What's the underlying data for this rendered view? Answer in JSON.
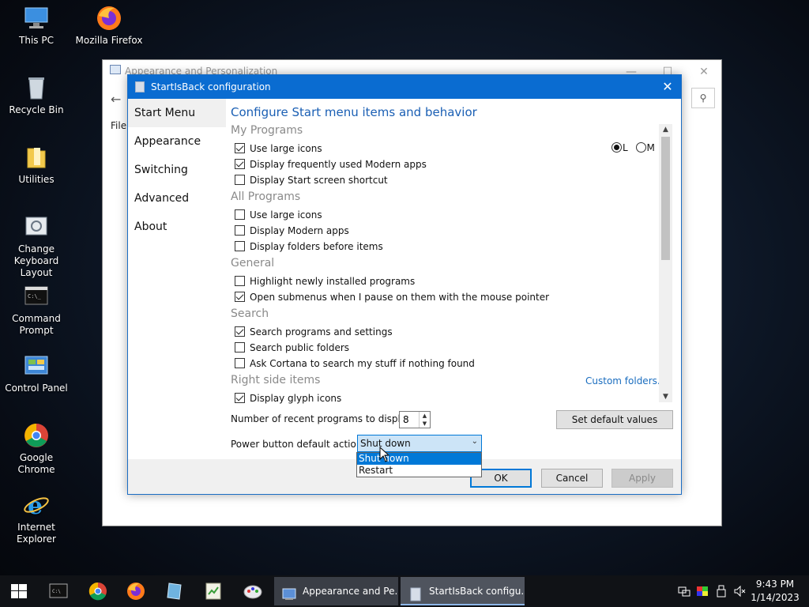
{
  "desktop": {
    "icons": [
      {
        "label": "This PC",
        "icon": "computer-icon"
      },
      {
        "label": "Mozilla Firefox",
        "icon": "firefox-icon"
      },
      {
        "label": "Recycle Bin",
        "icon": "recycle-bin-icon"
      },
      {
        "label": "Utilities",
        "icon": "folder-icon"
      },
      {
        "label": "Change Keyboard Layout",
        "icon": "keyboard-icon"
      },
      {
        "label": "Command Prompt",
        "icon": "cmd-icon"
      },
      {
        "label": "Control Panel",
        "icon": "control-panel-icon"
      },
      {
        "label": "Google Chrome",
        "icon": "chrome-icon"
      },
      {
        "label": "Internet Explorer",
        "icon": "ie-icon"
      }
    ]
  },
  "bg_window": {
    "title": "Appearance and Personalization",
    "back_glyph": "←",
    "file_menu": "File",
    "minimize_glyph": "—",
    "maximize_glyph": "☐",
    "close_glyph": "✕",
    "search_glyph": "⚲"
  },
  "dialog": {
    "title": "StartIsBack configuration",
    "close_glyph": "✕",
    "nav": [
      "Start Menu",
      "Appearance",
      "Switching",
      "Advanced",
      "About"
    ],
    "heading": "Configure Start menu items and behavior",
    "sections": {
      "my_programs": "My Programs",
      "all_programs": "All Programs",
      "general": "General",
      "search": "Search",
      "right_side": "Right side items"
    },
    "options": {
      "use_large_icons_mp": "Use large icons",
      "display_modern_frequent": "Display frequently used Modern apps",
      "display_start_shortcut": "Display Start screen shortcut",
      "use_large_icons_ap": "Use large icons",
      "display_modern_apps": "Display Modern apps",
      "display_folders_before": "Display folders before items",
      "highlight_new": "Highlight newly installed programs",
      "open_submenus": "Open submenus when I pause on them with the mouse pointer",
      "search_programs": "Search programs and settings",
      "search_public": "Search public folders",
      "ask_cortana": "Ask Cortana to search my stuff if nothing found",
      "display_glyph": "Display glyph icons"
    },
    "size_radio": {
      "large": "L",
      "medium": "M"
    },
    "custom_folders": "Custom folders...",
    "scroll_up": "▲",
    "scroll_down": "▼",
    "recent_label": "Number of recent programs to display:",
    "recent_value": "8",
    "spin_up": "▲",
    "spin_down": "▼",
    "set_default": "Set default values",
    "power_label": "Power button default action:",
    "power_value": "Shut down",
    "power_chevron": "⌄",
    "power_options": [
      "Shut down",
      "Restart"
    ],
    "ok": "OK",
    "cancel": "Cancel",
    "apply": "Apply"
  },
  "taskbar": {
    "tasks": [
      "Appearance and Pe...",
      "StartIsBack configu..."
    ],
    "time": "9:43 PM",
    "date": "1/14/2023"
  },
  "colors": {
    "accent": "#0a6cd1",
    "heading": "#1a5fb4",
    "section": "#8a8a8a",
    "link": "#1a6dbf"
  }
}
